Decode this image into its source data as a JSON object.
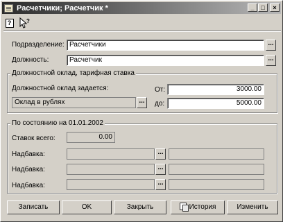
{
  "window": {
    "title": "Расчетчики; Расчетчик *",
    "title_buttons": {
      "minimize": "_",
      "maximize": "□",
      "close": "×"
    }
  },
  "toolbar": {
    "help_glyph": "?",
    "help_icon": "help-icon",
    "pointer_icon": "pointer-help-icon"
  },
  "form": {
    "department": {
      "label": "Подразделение:",
      "value": "Расчетчики"
    },
    "position": {
      "label": "Должность:",
      "value": "Расчетчик"
    },
    "ellipsis": "..."
  },
  "salary_group": {
    "title": "Должностной оклад, тарифная ставка",
    "set_label": "Должностной оклад задается:",
    "mode_value": "Оклад в рублях",
    "from_label": "От:",
    "from_value": "3000.00",
    "to_label": "до:",
    "to_value": "5000.00"
  },
  "state_group": {
    "title": "По состоянию на 01.01.2002",
    "rates_label": "Ставок всего:",
    "rates_value": "0.00",
    "allowances": [
      {
        "label": "Надбавка:",
        "value": "",
        "extra": ""
      },
      {
        "label": "Надбавка:",
        "value": "",
        "extra": ""
      },
      {
        "label": "Надбавка:",
        "value": "",
        "extra": ""
      }
    ]
  },
  "buttons": {
    "record": "Записать",
    "ok": "OK",
    "close": "Закрыть",
    "history": "История",
    "change": "Изменить"
  }
}
